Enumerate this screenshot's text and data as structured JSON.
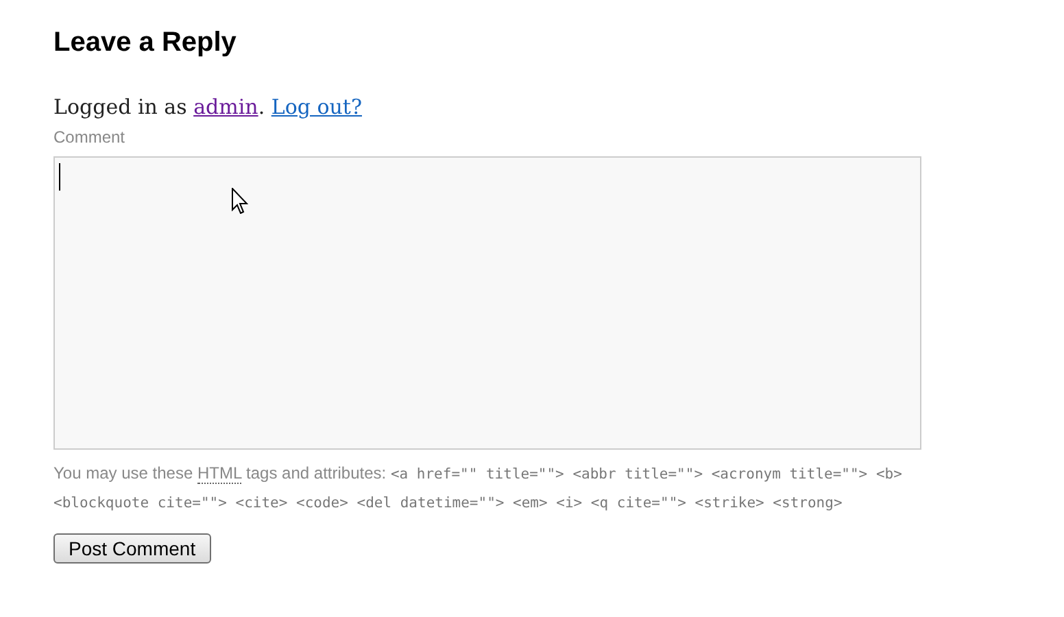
{
  "heading": "Leave a Reply",
  "logged_in": {
    "prefix": "Logged in as ",
    "user": "admin",
    "separator": ". ",
    "logout": "Log out?"
  },
  "comment": {
    "label": "Comment"
  },
  "allowed_tags": {
    "prefix": "You may use these ",
    "abbr": "HTML",
    "middle": " tags and attributes: ",
    "tags": "<a href=\"\" title=\"\"> <abbr title=\"\"> <acronym title=\"\"> <b> <blockquote cite=\"\"> <cite> <code> <del datetime=\"\"> <em> <i> <q cite=\"\"> <strike> <strong>"
  },
  "submit": {
    "label": "Post Comment"
  }
}
